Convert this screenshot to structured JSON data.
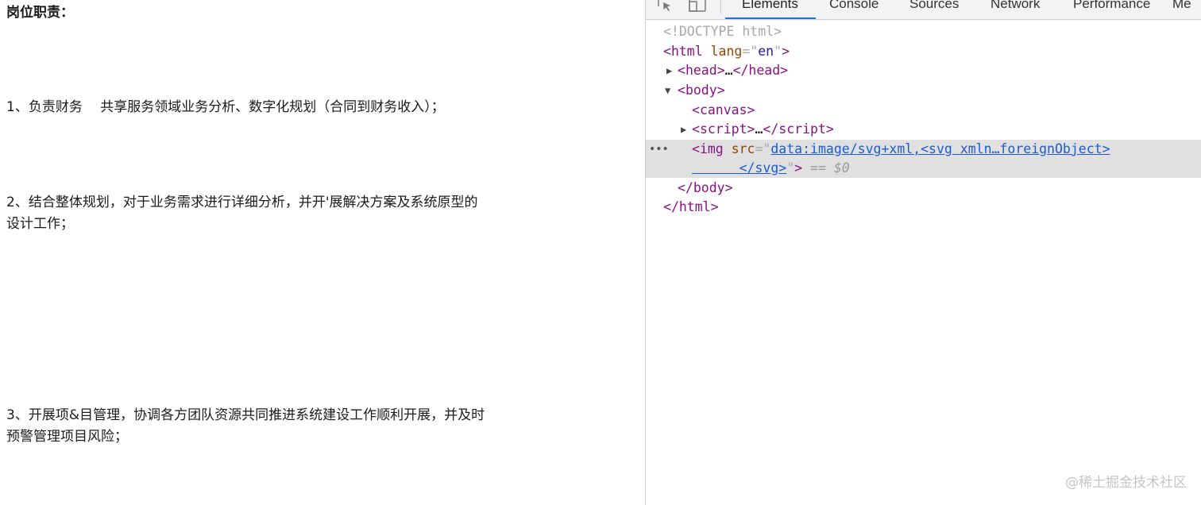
{
  "page": {
    "heading": "岗位职责：",
    "item1": "1、负责财务　 共享服务领域业务分析、数字化规划（合同到财务收入）；",
    "item2_line1": " 2、结合整体规划，对于业务需求进行详细分析，并开'展解决方案及系统原型的",
    "item2_line2": "设计工作；",
    "item3_line1": " 3、开展项&目管理，协调各方团队资源共同推进系统建设工作顺利开展，并及时",
    "item3_line2": "预警管理项目风险；"
  },
  "devtools": {
    "icons": [
      "inspect-element-icon",
      "device-toolbar-icon"
    ],
    "tabs": [
      {
        "label": "Elements",
        "active": true
      },
      {
        "label": "Console",
        "active": false
      },
      {
        "label": "Sources",
        "active": false
      },
      {
        "label": "Network",
        "active": false
      },
      {
        "label": "Performance",
        "active": false
      },
      {
        "label": "Me",
        "active": false
      }
    ],
    "accent_color": "#1a73e8",
    "dom": {
      "doctype": "<!DOCTYPE html>",
      "html_open_tag": "html",
      "html_attr_name": "lang",
      "html_attr_value": "en",
      "head_text": "head",
      "head_close": "/head",
      "body_open": "body",
      "canvas": "canvas",
      "script_open": "script",
      "script_close": "/script",
      "img_tag": "img",
      "img_attr": "src",
      "img_src_line1": "data:image/svg+xml,<svg xmln…foreignObject>",
      "img_src_line2": "</svg>",
      "selected_marker": "$0",
      "body_close": "/body",
      "html_close": "/html"
    }
  },
  "watermark": "@稀土掘金技术社区"
}
